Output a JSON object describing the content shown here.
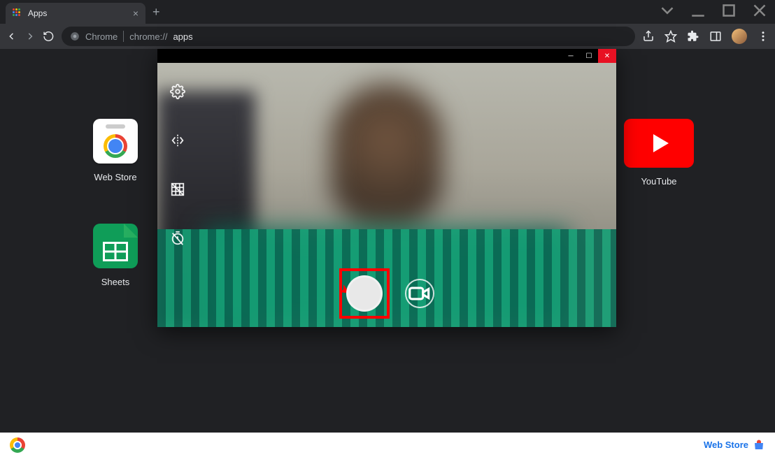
{
  "chrome": {
    "tab_title": "Apps",
    "url_prefix": "Chrome",
    "url_scheme": "chrome://",
    "url_path": "apps"
  },
  "apps": {
    "webstore": "Web Store",
    "sheets": "Sheets",
    "youtube": "YouTube"
  },
  "bottombar": {
    "webstore": "Web Store"
  }
}
